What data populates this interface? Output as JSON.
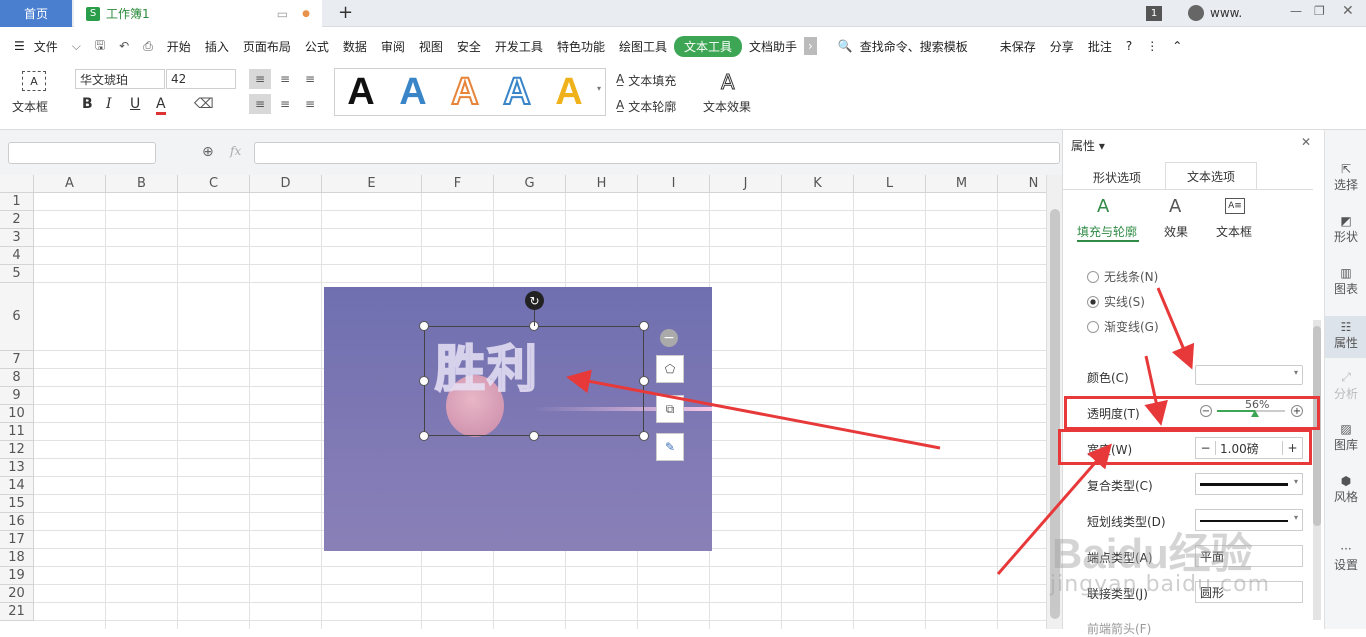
{
  "tabs": {
    "home": "首页",
    "doc": "工作簿1",
    "add": "+",
    "badge": "1",
    "user": "www."
  },
  "menu": {
    "file": "文件",
    "items": [
      "开始",
      "插入",
      "页面布局",
      "公式",
      "数据",
      "审阅",
      "视图",
      "安全",
      "开发工具",
      "特色功能",
      "绘图工具",
      "文本工具",
      "文档助手"
    ],
    "search": "查找命令、搜索模板",
    "unsaved": "未保存",
    "share": "分享",
    "comment": "批注"
  },
  "ribbon": {
    "textbox": "文本框",
    "font": "华文琥珀",
    "size": "42",
    "bold": "B",
    "italic": "I",
    "underline": "U",
    "fontcolor": "A",
    "art_letter": "A",
    "fill": "文本填充",
    "outline": "文本轮廓",
    "effect": "文本效果"
  },
  "formula": {
    "fx": "fx"
  },
  "sheet": {
    "columns": [
      "A",
      "B",
      "C",
      "D",
      "E",
      "F",
      "G",
      "H",
      "I",
      "J",
      "K",
      "L",
      "M",
      "N"
    ],
    "rows": [
      "1",
      "2",
      "3",
      "4",
      "5",
      "6",
      "7",
      "8",
      "9",
      "10",
      "11",
      "12",
      "13",
      "14",
      "15",
      "16",
      "17",
      "18",
      "19",
      "20",
      "21"
    ]
  },
  "textbox_content": "胜利",
  "panel": {
    "title": "属性",
    "tab_shape": "形状选项",
    "tab_text": "文本选项",
    "sub_fill": "填充与轮廓",
    "sub_effect": "效果",
    "sub_box": "文本框",
    "no_line": "无线条(N)",
    "solid_line": "实线(S)",
    "gradient_line": "渐变线(G)",
    "color": "颜色(C)",
    "transparency": "透明度(T)",
    "transparency_value": "56%",
    "width": "宽度(W)",
    "width_value": "1.00磅",
    "compound": "复合类型(C)",
    "dash": "短划线类型(D)",
    "cap": "端点类型(A)",
    "cap_value": "平面",
    "join": "联接类型(J)",
    "join_value": "圆形",
    "front_arrow": "前端箭头(F)"
  },
  "rail": [
    "选择",
    "形状",
    "图表",
    "属性",
    "分析",
    "图库",
    "风格",
    "设置"
  ],
  "watermark": {
    "main": "Baidu经验",
    "sub": "jingyan.baidu.com"
  },
  "colors": {
    "accent_green": "#3da654",
    "arrow_red": "#e8393a",
    "tab_blue": "#4a7fd0"
  }
}
